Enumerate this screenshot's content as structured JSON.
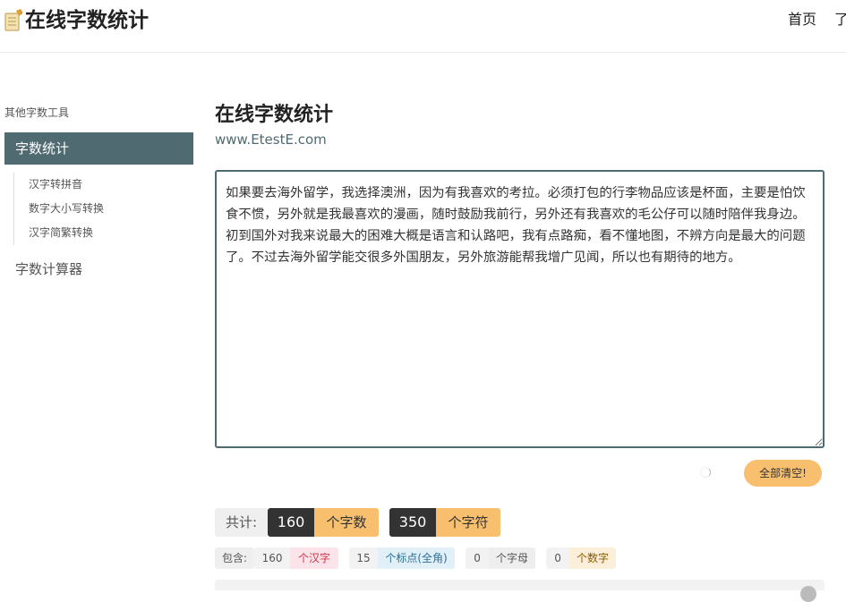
{
  "header": {
    "logo_text": "在线字数统计",
    "nav": [
      "首页",
      "了"
    ]
  },
  "sidebar": {
    "heading": "其他字数工具",
    "active_item": "字数统计",
    "sub_items": [
      "汉字转拼音",
      "数字大小写转换",
      "汉字简繁转换"
    ],
    "item": "字数计算器"
  },
  "main": {
    "title": "在线字数统计",
    "subtitle": "www.EtestE.com",
    "editor_text": "如果要去海外留学，我选择澳洲，因为有我喜欢的考拉。必须打包的行李物品应该是杯面，主要是怕饮食不惯，另外就是我最喜欢的漫画，随时鼓励我前行，另外还有我喜欢的毛公仔可以随时陪伴我身边。初到国外对我来说最大的困难大概是语言和认路吧，我有点路痴，看不懂地图，不辨方向是最大的问题了。不过去海外留学能交很多外国朋友，另外旅游能帮我增广见闻，所以也有期待的地方。",
    "clear_button": "全部清空!",
    "total_label": "共计:",
    "total_chars_value": "160",
    "total_chars_unit": "个字数",
    "total_symbols_value": "350",
    "total_symbols_unit": "个字符",
    "contains_label": "包含:",
    "breakdown": [
      {
        "value": "160",
        "unit": "个汉字",
        "color": "#d0334a",
        "bg": "#fbe3ea"
      },
      {
        "value": "15",
        "unit": "个标点(全角)",
        "color": "#2a6f97",
        "bg": "#e1eff7"
      },
      {
        "value": "0",
        "unit": "个字母",
        "color": "#555555",
        "bg": "#eeeeee"
      },
      {
        "value": "0",
        "unit": "个数字",
        "color": "#8a5a00",
        "bg": "#fbefd9"
      }
    ]
  },
  "colors": {
    "accent": "#4f6a70",
    "highlight": "#f8bf6e",
    "dark": "#333333"
  }
}
